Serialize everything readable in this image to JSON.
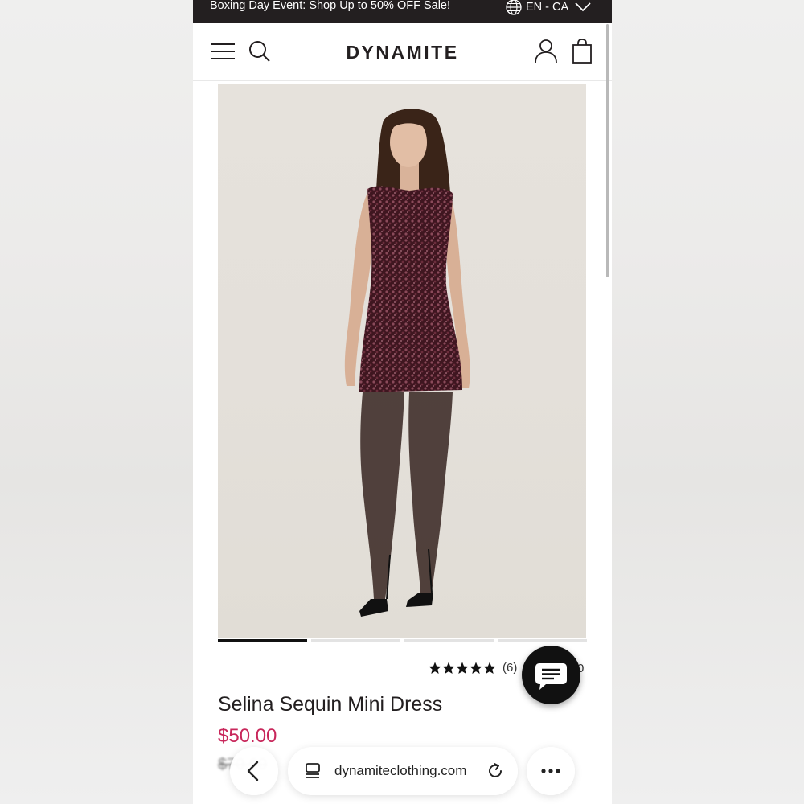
{
  "promo": {
    "text": "Boxing Day Event: Shop Up to 50% OFF Sale!"
  },
  "locale": {
    "label": "EN - CA"
  },
  "header": {
    "logo": "DYNAMITE"
  },
  "product": {
    "title": "Selina Sequin Mini Dress",
    "price": "$50.00",
    "old_price": "$70.00",
    "rating_count": "(6)",
    "rating_stars": 5,
    "partially_hidden_text": "0"
  },
  "carousel": {
    "total_slides": 4,
    "active_index": 0
  },
  "browser": {
    "url": "dynamiteclothing.com"
  },
  "colors": {
    "promo_bg": "#231f20",
    "price": "#c8275b",
    "dress": "#4a1e28"
  },
  "icons": [
    "globe-icon",
    "chevron-down-icon",
    "hamburger-menu-icon",
    "search-icon",
    "account-icon",
    "shopping-bag-icon",
    "star-icon",
    "chat-icon",
    "back-arrow-icon",
    "tabs-icon",
    "reload-icon",
    "more-icon"
  ]
}
